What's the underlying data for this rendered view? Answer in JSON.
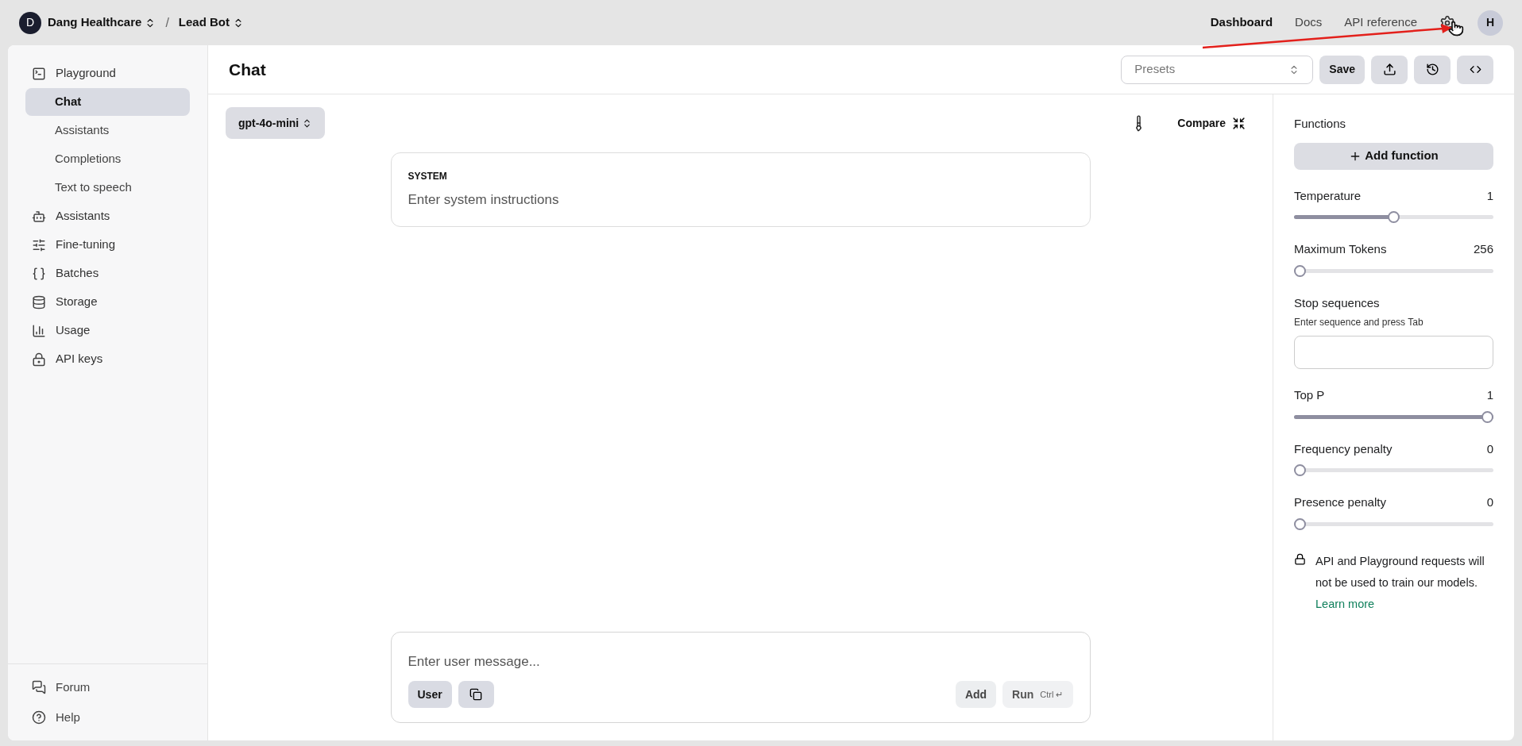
{
  "topbar": {
    "org": {
      "initial": "D",
      "name": "Dang Healthcare"
    },
    "separator": "/",
    "project": "Lead Bot",
    "nav": [
      {
        "label": "Dashboard",
        "selected": true
      },
      {
        "label": "Docs",
        "selected": false
      },
      {
        "label": "API reference",
        "selected": false
      }
    ],
    "avatar": "H"
  },
  "sidebar": {
    "items": [
      {
        "label": "Playground",
        "selected": false,
        "children": [
          {
            "label": "Chat",
            "selected": true
          },
          {
            "label": "Assistants",
            "selected": false
          },
          {
            "label": "Completions",
            "selected": false
          },
          {
            "label": "Text to speech",
            "selected": false
          }
        ]
      },
      {
        "label": "Assistants",
        "selected": false
      },
      {
        "label": "Fine-tuning",
        "selected": false
      },
      {
        "label": "Batches",
        "selected": false
      },
      {
        "label": "Storage",
        "selected": false
      },
      {
        "label": "Usage",
        "selected": false
      },
      {
        "label": "API keys",
        "selected": false
      }
    ],
    "footer": [
      {
        "label": "Forum"
      },
      {
        "label": "Help"
      }
    ]
  },
  "header": {
    "title": "Chat",
    "presets": {
      "placeholder": "Presets"
    },
    "save": "Save"
  },
  "chat": {
    "model": "gpt-4o-mini",
    "compare": "Compare",
    "system": {
      "label": "SYSTEM",
      "placeholder": "Enter system instructions"
    },
    "composer": {
      "placeholder": "Enter user message...",
      "role": "User",
      "add": "Add",
      "run": "Run",
      "shortcut": "Ctrl ↵"
    }
  },
  "settings": {
    "functions": {
      "label": "Functions",
      "button": "Add function"
    },
    "sliders": [
      {
        "label": "Temperature",
        "reading": "1",
        "level": 0.5
      },
      {
        "label": "Maximum Tokens",
        "reading": "256",
        "level": 0
      }
    ],
    "stop": {
      "label": "Stop sequences",
      "hint": "Enter sequence and press Tab"
    },
    "sliders2": [
      {
        "label": "Top P",
        "reading": "1",
        "level": 1
      },
      {
        "label": "Frequency penalty",
        "reading": "0",
        "level": 0
      },
      {
        "label": "Presence penalty",
        "reading": "0",
        "level": 0
      }
    ],
    "notice": "API and Playground requests will not be used to train our models.",
    "link": "Learn more"
  }
}
